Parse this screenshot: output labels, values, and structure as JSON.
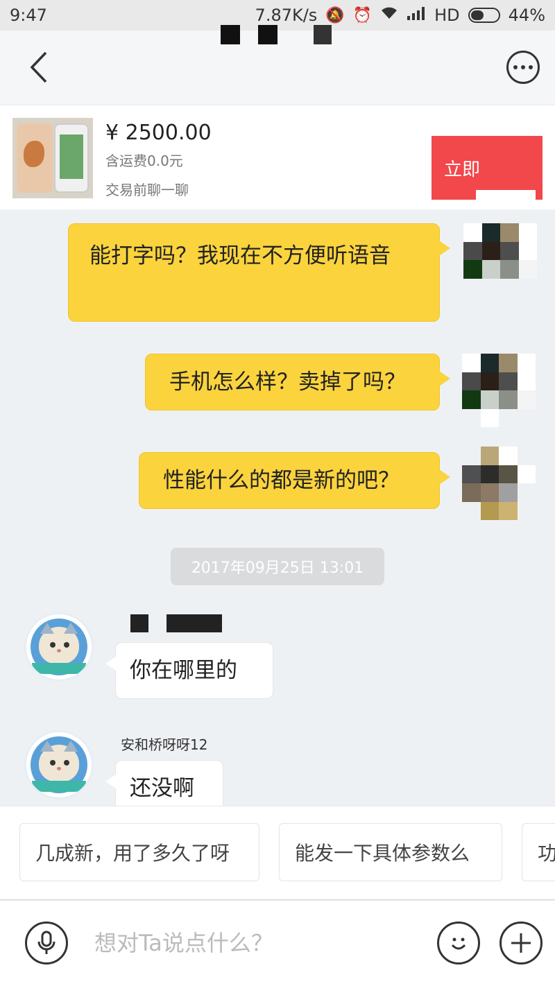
{
  "status_bar": {
    "time": "9:47",
    "speed": "7.87K/s",
    "network": "HD",
    "battery": "44%",
    "battery_level": 0.44
  },
  "header": {
    "back_icon": "back-chevron-icon",
    "more_icon": "more-dots-icon"
  },
  "product": {
    "price": "¥ 2500.00",
    "shipping": "含运费0.0元",
    "note": "交易前聊一聊",
    "buy_label": "立即"
  },
  "messages": {
    "m1": "能打字吗？我现在不方便听语音",
    "m2": "手机怎么样？卖掉了吗？",
    "m3": "性能什么的都是新的吧？",
    "timestamp": "2017年09月25日 13:01",
    "m4": "你在哪里的",
    "m5_sender": "安和桥呀呀12",
    "m5": "还没啊"
  },
  "quick_replies": [
    "几成新，用了多久了呀",
    "能发一下具体参数么",
    "功"
  ],
  "input": {
    "placeholder": "想对Ta说点什么？",
    "voice_icon": "microphone-icon",
    "emoji_icon": "smiley-icon",
    "add_icon": "plus-icon"
  },
  "colors": {
    "accent_yellow": "#fbd33d",
    "buy_red": "#f2474b"
  }
}
